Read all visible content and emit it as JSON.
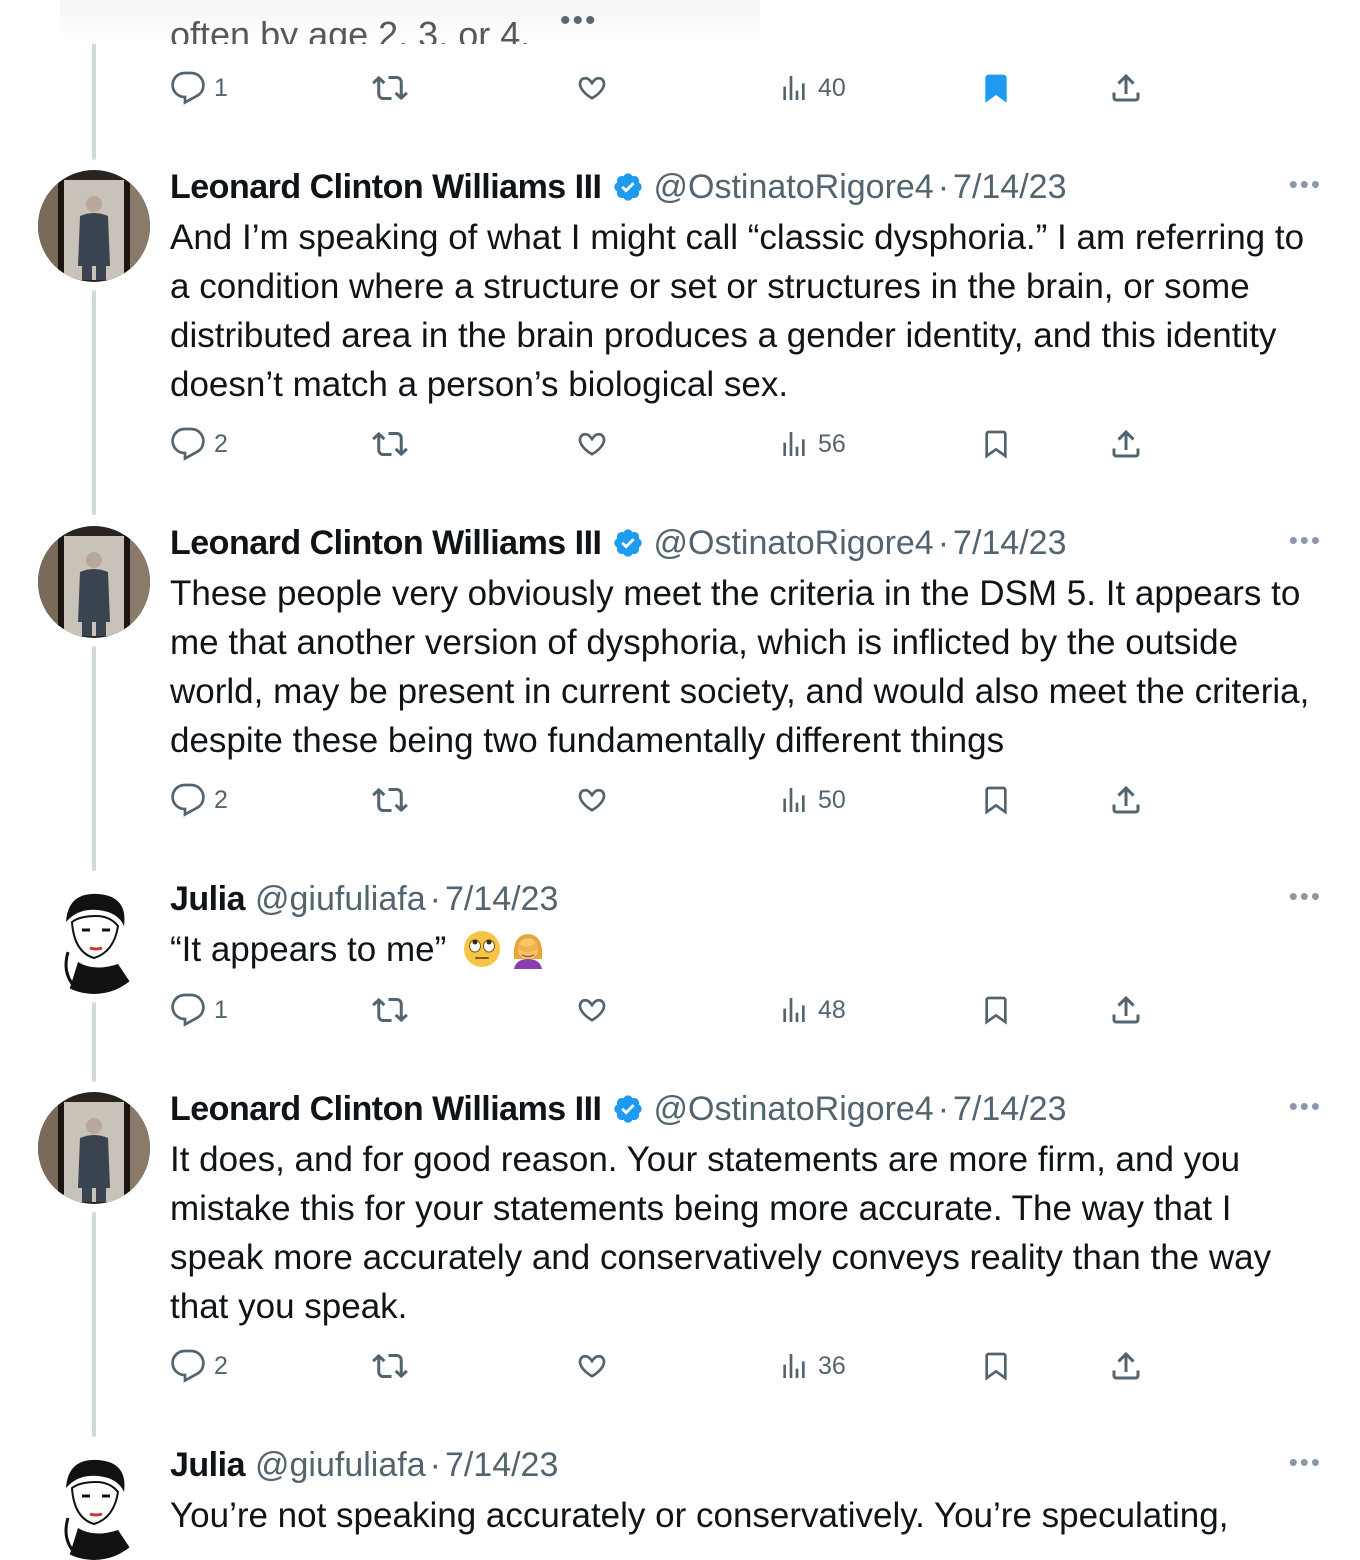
{
  "top_partial": {
    "clipped_text": "often by age 2, 3, or 4.",
    "actions": {
      "replies": "1",
      "views": "40",
      "bookmarked": true
    }
  },
  "tweets": [
    {
      "name": "Leonard Clinton Williams III",
      "verified": true,
      "handle": "@OstinatoRigore4",
      "sep": "·",
      "date": "7/14/23",
      "text": "And I’m speaking of what I might call “classic dysphoria.” I am referring to a condition where a structure or set or structures in the brain, or some distributed area in the brain produces a gender identity, and this identity doesn’t match a person’s biological sex.",
      "replies": "2",
      "views": "56"
    },
    {
      "name": "Leonard Clinton Williams III",
      "verified": true,
      "handle": "@OstinatoRigore4",
      "sep": "·",
      "date": "7/14/23",
      "text": "These people very obviously meet the criteria in the DSM 5. It appears to me that another version of dysphoria, which is inflicted by the outside world, may be present in current society, and would also meet the criteria, despite these being two fundamentally different things",
      "replies": "2",
      "views": "50"
    },
    {
      "name": "Julia",
      "verified": false,
      "handle": "@giufuliafa",
      "sep": "·",
      "date": "7/14/23",
      "text": "“It appears to me”",
      "emojis": [
        "face-with-rolling-eyes-emoji",
        "woman-facepalming-emoji"
      ],
      "replies": "1",
      "views": "48"
    },
    {
      "name": "Leonard Clinton Williams III",
      "verified": true,
      "handle": "@OstinatoRigore4",
      "sep": "·",
      "date": "7/14/23",
      "text": "It does, and for good reason. Your statements are more firm, and you mistake this for your statements being more accurate. The way that I speak more accurately and conservatively conveys reality than the way that you speak.",
      "replies": "2",
      "views": "36"
    },
    {
      "name": "Julia",
      "verified": false,
      "handle": "@giufuliafa",
      "sep": "·",
      "date": "7/14/23",
      "text": "You’re not speaking accurately or conservatively. You’re speculating,"
    }
  ],
  "icons": {
    "reply": "reply-icon",
    "retweet": "retweet-icon",
    "like": "like-icon",
    "views": "views-icon",
    "bookmark": "bookmark-icon",
    "share": "share-icon",
    "more": "more-icon",
    "verified": "verified-badge-icon"
  },
  "colors": {
    "text": "#0f1419",
    "secondary": "#536471",
    "verified_blue": "#1d9bf0",
    "bookmark_active": "#1d9bf0",
    "thread_line": "#cfd9de"
  },
  "more_label": "•••"
}
